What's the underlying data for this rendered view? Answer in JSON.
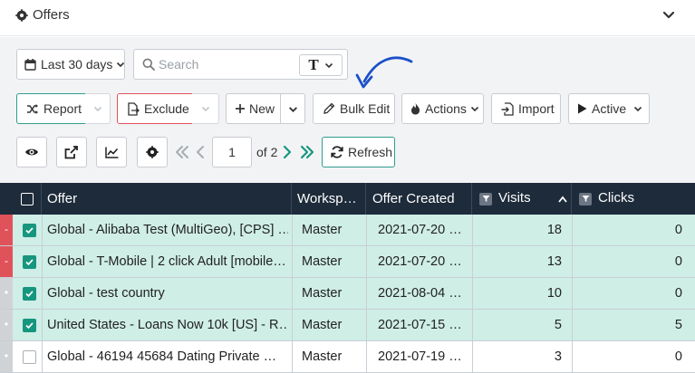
{
  "header": {
    "title": "Offers",
    "gear_icon": "gear-icon",
    "collapse_icon": "chevron-down-icon"
  },
  "toolbar": {
    "date_range": "Last 30 days",
    "search_placeholder": "Search",
    "search_type_glyph": "T",
    "report_label": "Report",
    "exclude_label": "Exclude",
    "new_label": "New",
    "bulk_edit_label": "Bulk Edit",
    "actions_label": "Actions",
    "import_label": "Import",
    "active_label": "Active",
    "refresh_label": "Refresh"
  },
  "pagination": {
    "current_page": "1",
    "of_label": "of 2"
  },
  "colors": {
    "accent": "#2f9e8f",
    "danger": "#e0525a",
    "header_bg": "#1d2b3a",
    "selected_row": "#cfeee6",
    "annotation_arrow": "#1a4fc9"
  },
  "table": {
    "columns": {
      "offer": "Offer",
      "workspace": "Worksp…",
      "created": "Offer Created",
      "visits": "Visits",
      "clicks": "Clicks"
    },
    "rows": [
      {
        "offer": "Global - Alibaba Test (MultiGeo), [CPS] …",
        "workspace": "Master",
        "created": "2021-07-20 …",
        "visits": "18",
        "clicks": "0",
        "marker": "-"
      },
      {
        "offer": "Global - T-Mobile | 2 click Adult [mobile…",
        "workspace": "Master",
        "created": "2021-07-20 …",
        "visits": "13",
        "clicks": "0",
        "marker": "-"
      },
      {
        "offer": "Global - test country",
        "workspace": "Master",
        "created": "2021-08-04 …",
        "visits": "10",
        "clicks": "0",
        "marker": "•"
      },
      {
        "offer": "United States - Loans Now 10k [US] - R…",
        "workspace": "Master",
        "created": "2021-07-15 …",
        "visits": "5",
        "clicks": "5",
        "marker": "•"
      },
      {
        "offer": "Global - 46194 45684 Dating Private …",
        "workspace": "Master",
        "created": "2021-07-19 …",
        "visits": "3",
        "clicks": "0",
        "marker": "•"
      }
    ]
  }
}
